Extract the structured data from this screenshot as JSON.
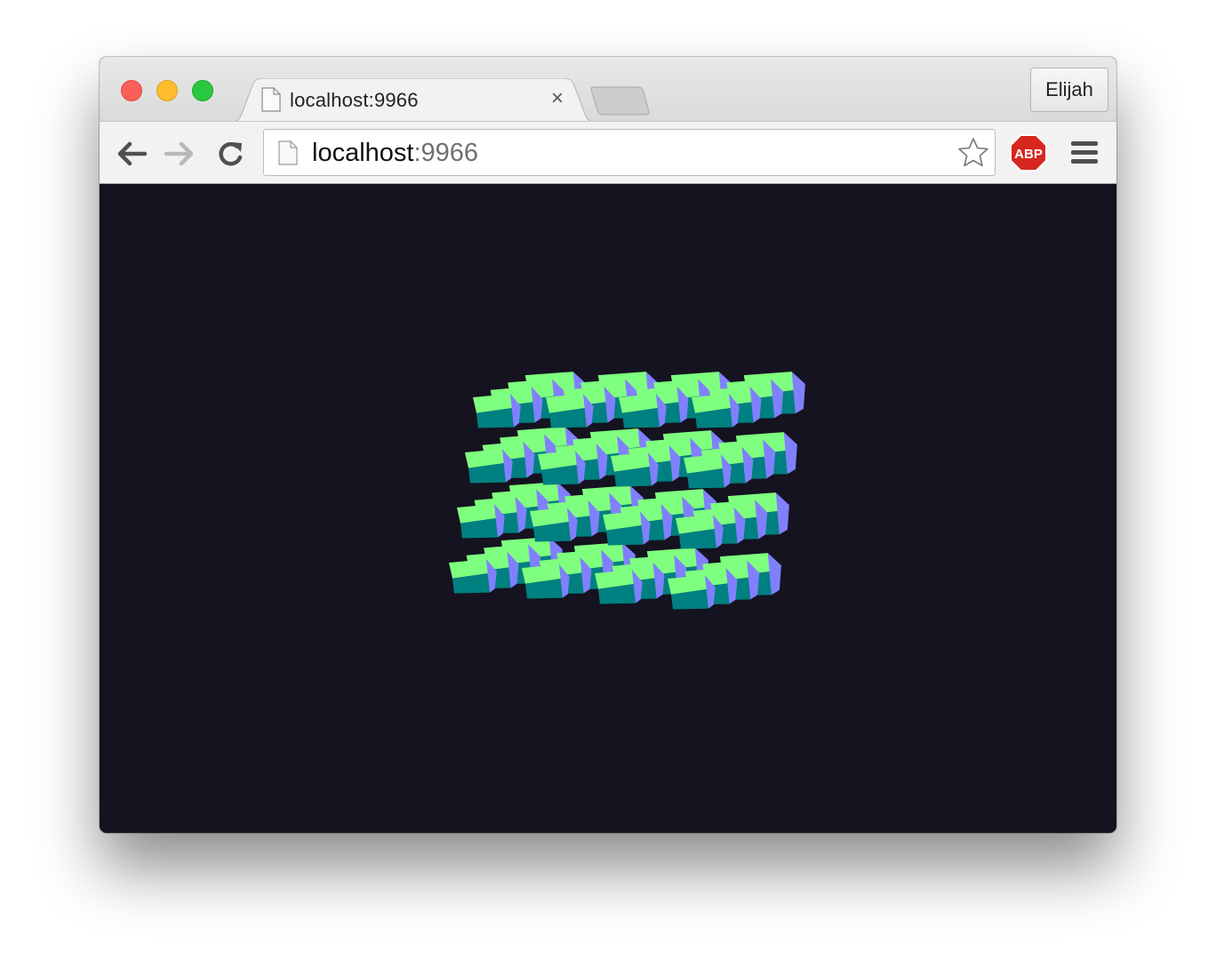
{
  "window": {
    "profile_name": "Elijah"
  },
  "tab": {
    "title": "localhost:9966",
    "close_glyph": "×",
    "favicon": "page-icon"
  },
  "toolbar": {
    "back_icon": "back-arrow-icon",
    "forward_icon": "forward-arrow-icon",
    "reload_icon": "reload-icon",
    "extension_label": "ABP",
    "menu_icon": "hamburger-menu-icon"
  },
  "omnibox": {
    "host": "localhost",
    "port": ":9966",
    "bookmark_icon": "star-icon"
  },
  "scene": {
    "background": "#14131f",
    "colors": {
      "top_face": "#7fff7f",
      "front_face": "#008080",
      "side_face": "#8080ff"
    }
  }
}
